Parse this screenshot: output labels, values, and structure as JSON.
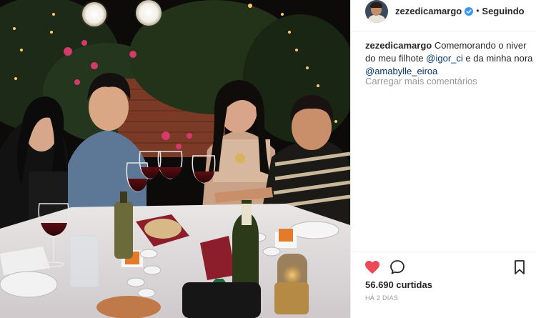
{
  "photo": {
    "alt": "Photo of friends at a dinner table toasting with wine glasses"
  },
  "header": {
    "username": "zezedicamargo",
    "verified_icon": "verified-badge-icon",
    "separator": "•",
    "follow_state": "Seguindo"
  },
  "caption": {
    "username": "zezedicamargo",
    "text_part1": "Comemorando o niver do meu filhote",
    "mention1": "@igor_ci",
    "text_part2": "e da minha nora",
    "mention2": "@amabylle_eiroa"
  },
  "comments": {
    "load_more": "Carregar mais comentários"
  },
  "actions": {
    "like_icon": "heart-filled-icon",
    "comment_icon": "comment-bubble-icon",
    "save_icon": "bookmark-icon",
    "like_color": "#ed4956"
  },
  "stats": {
    "likes": "56.690 curtidas",
    "posted": "HÁ 2 DIAS"
  }
}
